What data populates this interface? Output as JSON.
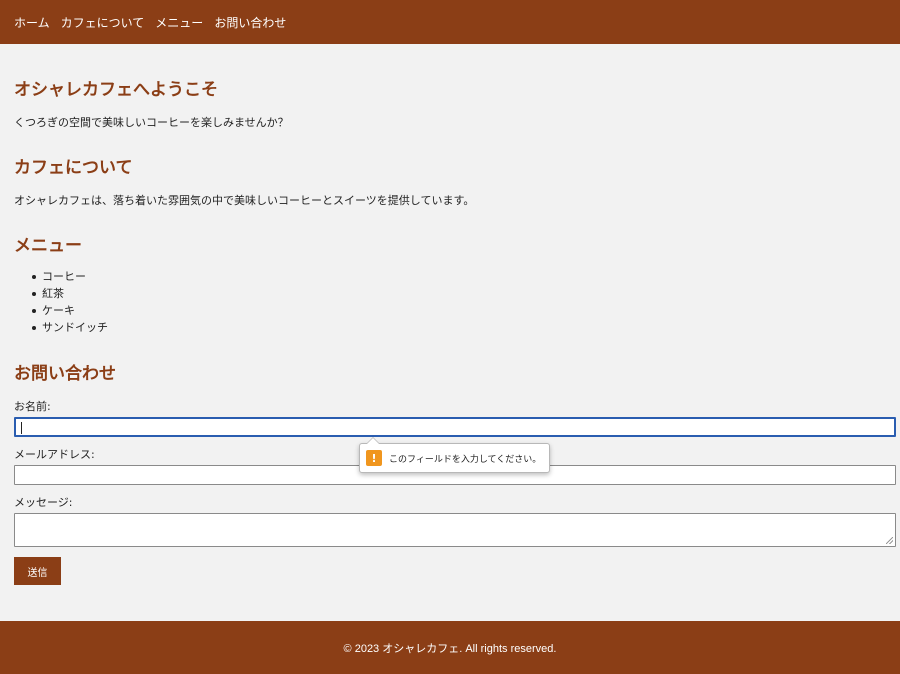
{
  "nav": {
    "items": [
      {
        "label": "ホーム"
      },
      {
        "label": "カフェについて"
      },
      {
        "label": "メニュー"
      },
      {
        "label": "お問い合わせ"
      }
    ]
  },
  "welcome": {
    "heading": "オシャレカフェへようこそ",
    "text": "くつろぎの空間で美味しいコーヒーを楽しみませんか？"
  },
  "about": {
    "heading": "カフェについて",
    "text": "オシャレカフェは、落ち着いた雰囲気の中で美味しいコーヒーとスイーツを提供しています。"
  },
  "menu": {
    "heading": "メニュー",
    "items": [
      "コーヒー",
      "紅茶",
      "ケーキ",
      "サンドイッチ"
    ]
  },
  "contact": {
    "heading": "お問い合わせ",
    "name_label": "お名前:",
    "name_value": "",
    "email_label": "メールアドレス:",
    "email_value": "",
    "message_label": "メッセージ:",
    "message_value": "",
    "submit_label": "送信",
    "validation_message": "このフィールドを入力してください。",
    "validation_icon": "warning-icon"
  },
  "footer": {
    "text": "© 2023 オシャレカフェ. All rights reserved."
  },
  "colors": {
    "brand": "#8b3e16",
    "background": "#f2f2f2",
    "focus": "#2a5db0",
    "warning": "#f0961e"
  }
}
